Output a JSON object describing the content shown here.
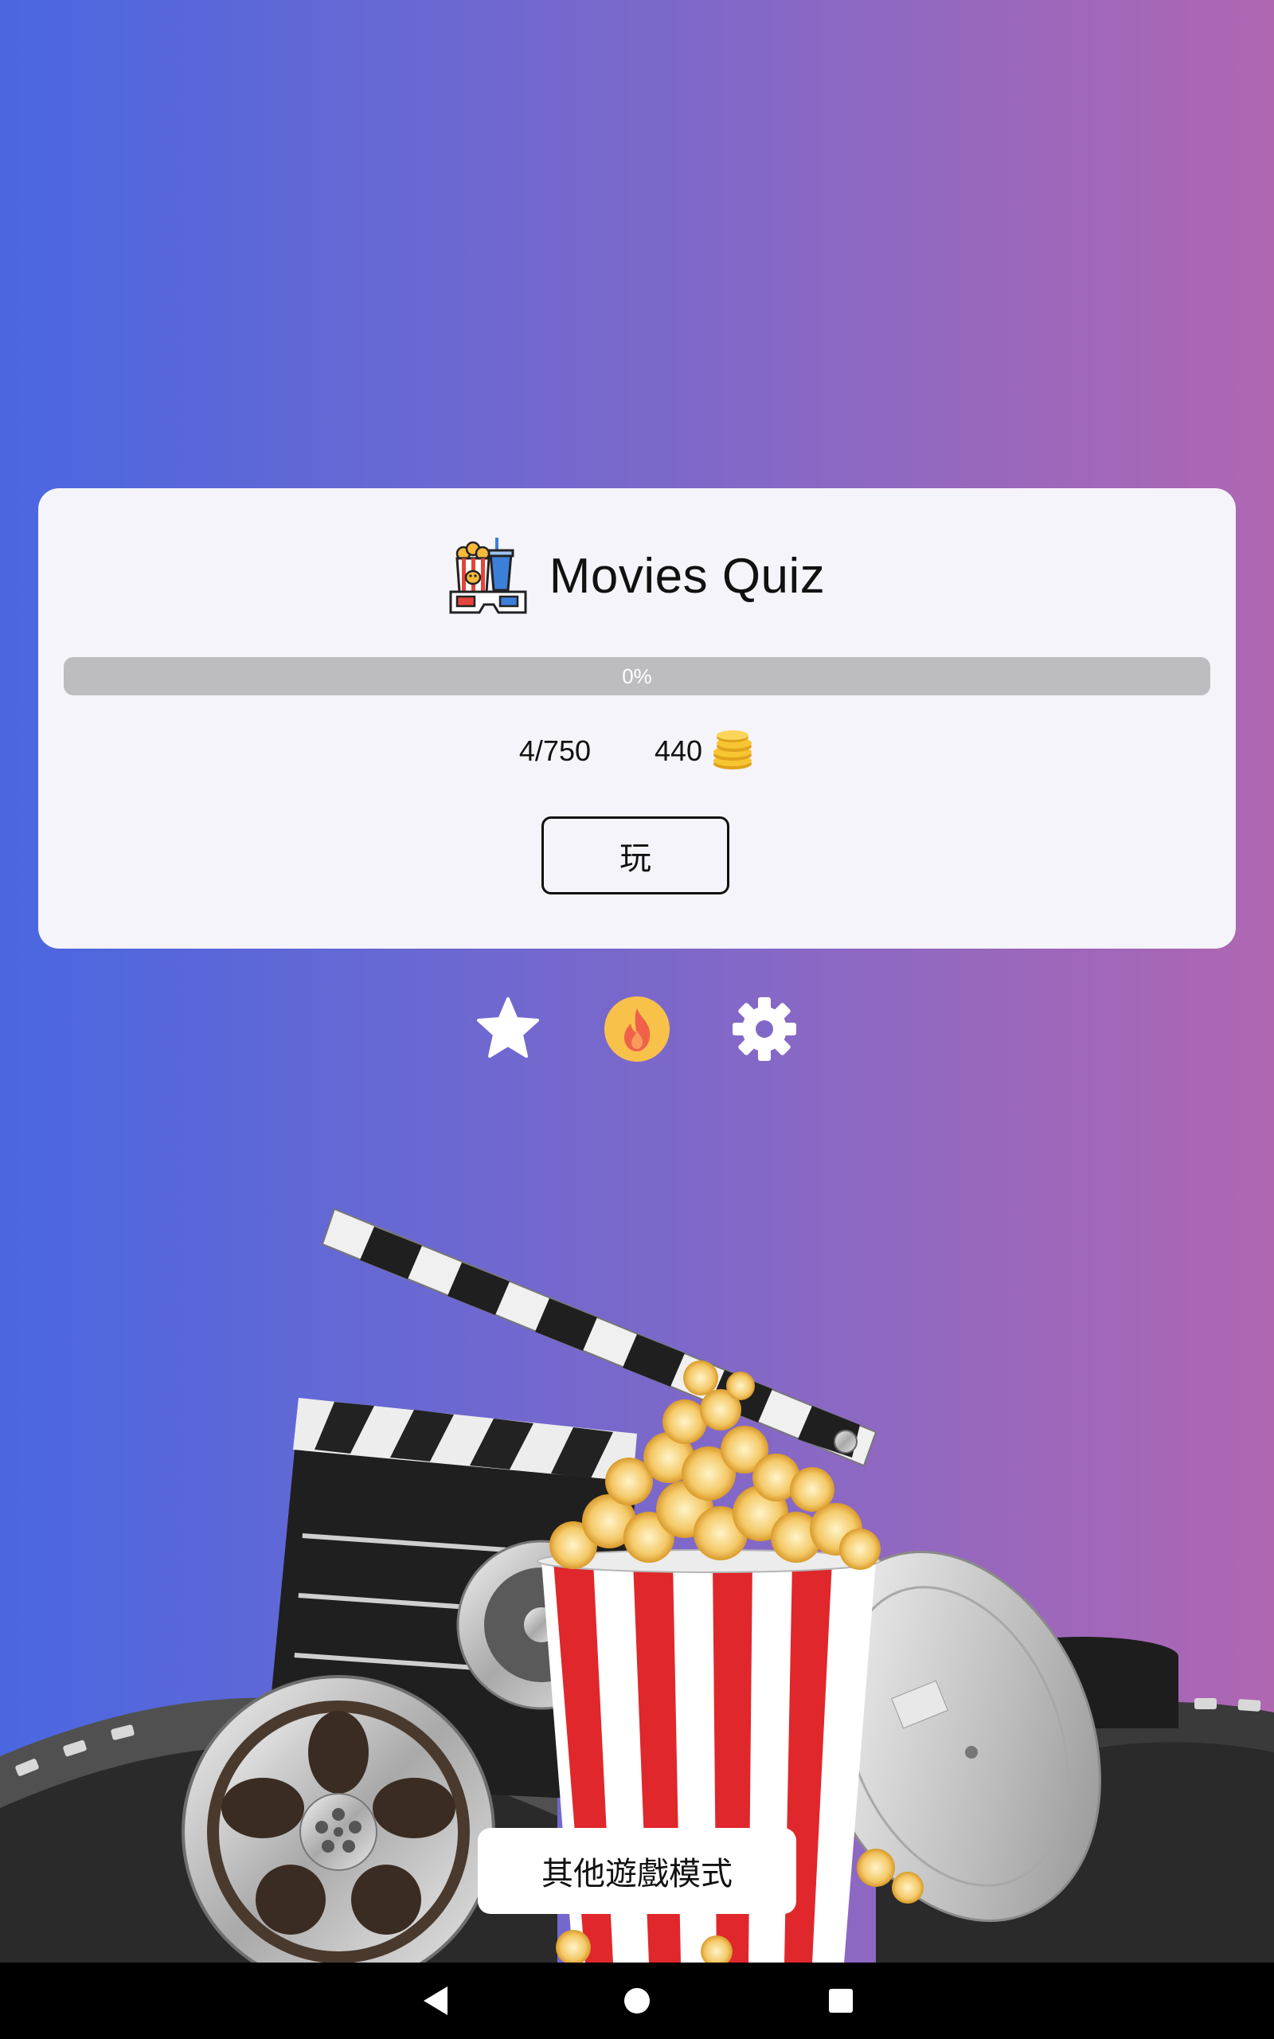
{
  "app": {
    "title": "Movies Quiz",
    "logo_icon": "popcorn-3d-glasses-icon"
  },
  "progress": {
    "label": "0%",
    "value": 0
  },
  "stats": {
    "levels": "4/750",
    "coins": "440",
    "coin_icon": "coin-stack-icon"
  },
  "buttons": {
    "play": "玩",
    "other_modes": "其他遊戲模式"
  },
  "bottom_icons": [
    {
      "name": "star-icon",
      "color": "#ffffff"
    },
    {
      "name": "fire-icon",
      "color": "#f7c14a"
    },
    {
      "name": "gear-icon",
      "color": "#ffffff"
    }
  ],
  "colors": {
    "gradient_start": "#4a67e0",
    "gradient_end": "#b067b2",
    "card_bg": "#f5f4fb",
    "progress_track": "#bdbcc0",
    "fire_circle": "#f7c14a",
    "fire_flame": "#f1614a"
  },
  "system_nav": [
    "back-icon",
    "home-icon",
    "recents-icon"
  ]
}
